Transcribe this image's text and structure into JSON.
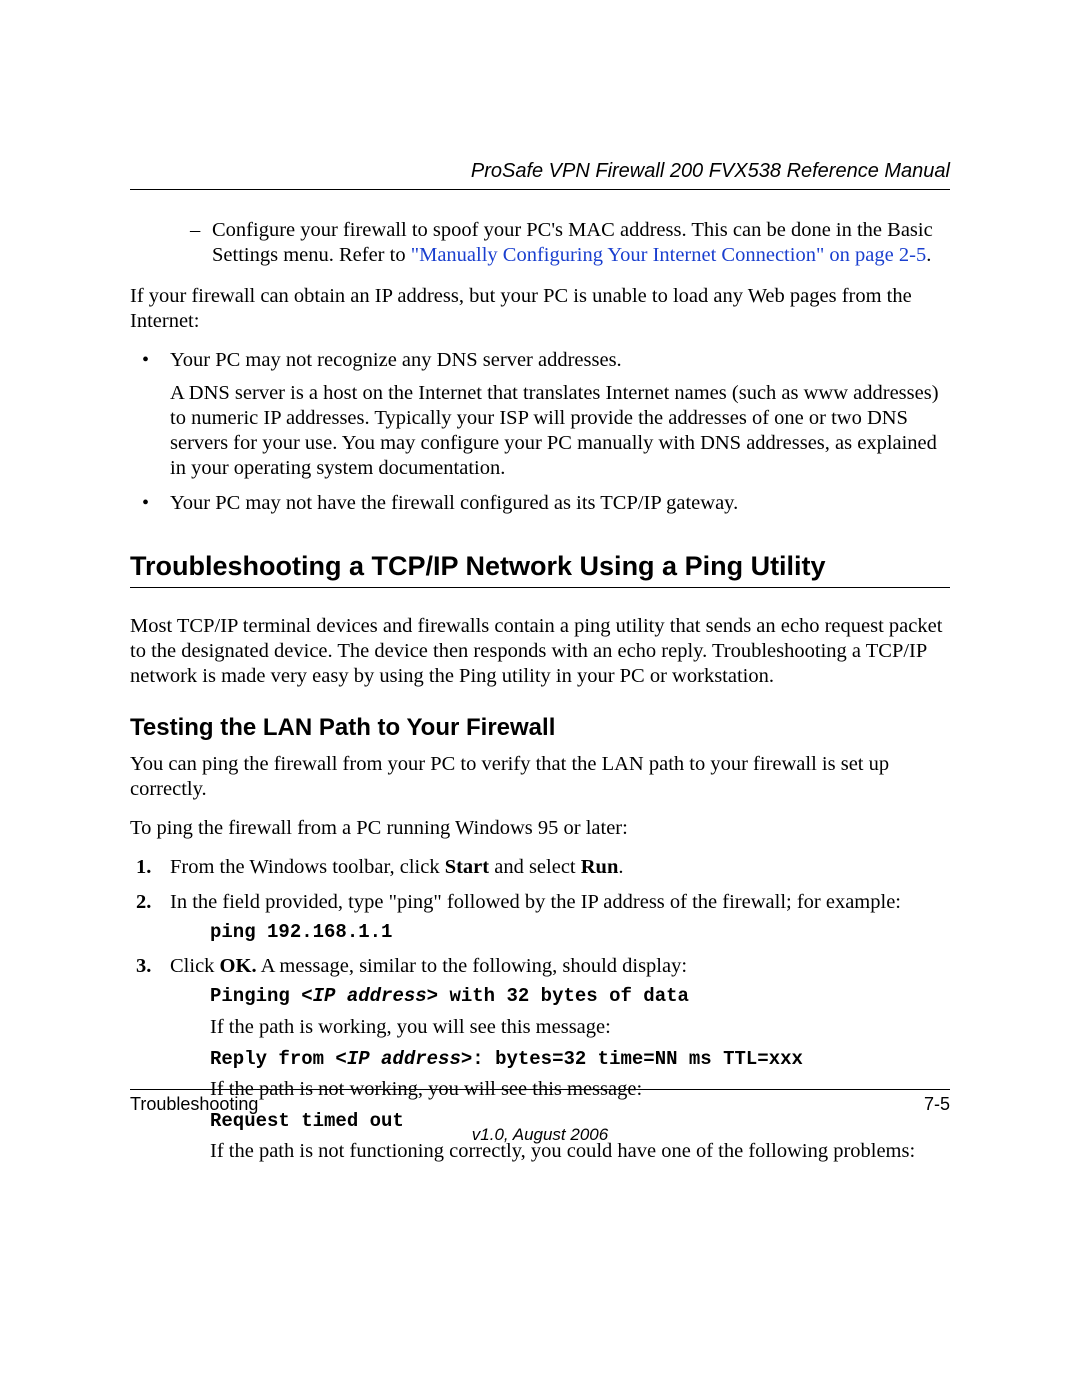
{
  "header": {
    "title": "ProSafe VPN Firewall 200 FVX538 Reference Manual"
  },
  "content": {
    "dash_item": {
      "prefix": "Configure your firewall to spoof your PC's MAC address. This can be done in the Basic Settings menu. Refer to ",
      "link": "\"Manually Configuring Your Internet Connection\" on page 2-5",
      "suffix": "."
    },
    "para1": "If your firewall can obtain an IP address, but your PC is unable to load any Web pages from the Internet:",
    "bullets": {
      "b1": "Your PC may not recognize any DNS server addresses.",
      "b1_sub": "A DNS server is a host on the Internet that translates Internet names (such as www addresses) to numeric IP addresses. Typically your ISP will provide the addresses of one or two DNS servers for your use. You may configure your PC manually with DNS addresses, as explained in your operating system documentation.",
      "b2": "Your PC may not have the firewall configured as its TCP/IP gateway."
    },
    "h2": "Troubleshooting a TCP/IP Network Using a Ping Utility",
    "h2_para": "Most TCP/IP terminal devices and firewalls contain a ping utility that sends an echo request packet to the designated device. The device then responds with an echo reply. Troubleshooting a TCP/IP network is made very easy by using the Ping utility in your PC or workstation.",
    "h3": "Testing the LAN Path to Your Firewall",
    "h3_para1": "You can ping the firewall from your PC to verify that the LAN path to your firewall is set up correctly.",
    "h3_para2": "To ping the firewall from a PC running Windows 95 or later:",
    "steps": {
      "s1_pre": "From the Windows toolbar, click ",
      "s1_b1": "Start",
      "s1_mid": " and select ",
      "s1_b2": "Run",
      "s1_post": ".",
      "s2": "In the field provided, type \"ping\" followed by the IP address of the firewall; for example:",
      "s2_code": "ping 192.168.1.1",
      "s3_pre": "Click ",
      "s3_b": "OK.",
      "s3_post": " A message, similar to the following, should display:",
      "s3_code_pre": "Pinging <",
      "s3_code_ital": "IP address",
      "s3_code_post": "> with 32 bytes of data",
      "s3_p1": "If the path is working, you will see this message:",
      "s3_code2_pre": "Reply from <",
      "s3_code2_ital": "IP address",
      "s3_code2_post": ">: bytes=32 time=NN ms TTL=xxx",
      "s3_p2": "If the path is not working, you will see this message:",
      "s3_code3": "Request timed out",
      "s3_p3": "If the path is not functioning correctly, you could have one of the following problems:"
    }
  },
  "footer": {
    "left": "Troubleshooting",
    "right": "7-5",
    "version": "v1.0, August 2006"
  }
}
